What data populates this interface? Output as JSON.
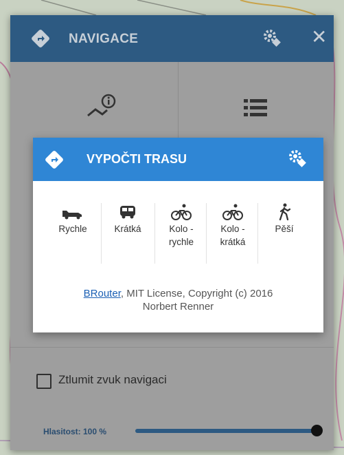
{
  "nav_dialog": {
    "title": "NAVIGACE",
    "mute_label": "Ztlumit zvuk navigaci",
    "mute_checked": false,
    "volume_label": "Hlasitost: 100 %",
    "volume_level": 1.0,
    "header_color": "#2d5a82"
  },
  "route_dialog": {
    "title": "VYPOČTI TRASU",
    "header_color": "#2f86d5",
    "modes": [
      {
        "icon": "car-icon",
        "line1": "Rychle",
        "line2": ""
      },
      {
        "icon": "bus-icon",
        "line1": "Krátká",
        "line2": ""
      },
      {
        "icon": "bicycle-icon",
        "line1": "Kolo -",
        "line2": "rychle"
      },
      {
        "icon": "bicycle-icon",
        "line1": "Kolo -",
        "line2": "krátká"
      },
      {
        "icon": "walking-icon",
        "line1": "Pěší",
        "line2": ""
      }
    ],
    "license_link": "BRouter",
    "license_rest": ", MIT License, Copyright (c) 2016",
    "license_line2": "Norbert Renner"
  }
}
